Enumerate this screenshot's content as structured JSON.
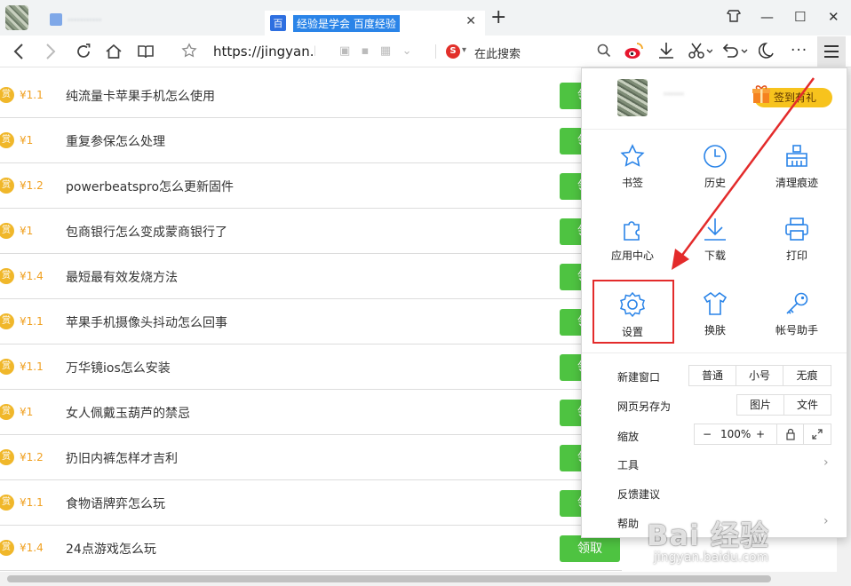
{
  "tabs": {
    "active_title": "经验是学会 百度经验",
    "inactive_title": "···········",
    "favicon_text": "百"
  },
  "window": {
    "minimize": "—",
    "maximize": "☐",
    "close": "✕",
    "wardrobe": "⌂"
  },
  "toolbar": {
    "url": "https://jingyan.b",
    "search_placeholder": "在此搜索",
    "sogou_glyph": "S"
  },
  "list": {
    "claim_label": "领取",
    "items": [
      {
        "reward": "¥1.1",
        "title": "纯流量卡苹果手机怎么使用"
      },
      {
        "reward": "¥1",
        "title": "重复参保怎么处理"
      },
      {
        "reward": "¥1.2",
        "title": "powerbeatspro怎么更新固件"
      },
      {
        "reward": "¥1",
        "title": "包商银行怎么变成蒙商银行了"
      },
      {
        "reward": "¥1.4",
        "title": "最短最有效发烧方法"
      },
      {
        "reward": "¥1.1",
        "title": "苹果手机摄像头抖动怎么回事"
      },
      {
        "reward": "¥1.1",
        "title": "万华镜ios怎么安装"
      },
      {
        "reward": "¥1",
        "title": "女人佩戴玉葫芦的禁忌"
      },
      {
        "reward": "¥1.2",
        "title": "扔旧内裤怎样才吉利"
      },
      {
        "reward": "¥1.1",
        "title": "食物语牌弈怎么玩"
      },
      {
        "reward": "¥1.4",
        "title": "24点游戏怎么玩"
      }
    ],
    "coin_glyph": "赏"
  },
  "menu": {
    "username": "······",
    "signin_label": "签到有礼",
    "grid": [
      {
        "label": "书签",
        "icon": "star-icon"
      },
      {
        "label": "历史",
        "icon": "clock-icon"
      },
      {
        "label": "清理痕迹",
        "icon": "broom-icon"
      },
      {
        "label": "应用中心",
        "icon": "puzzle-icon"
      },
      {
        "label": "下载",
        "icon": "download-icon"
      },
      {
        "label": "打印",
        "icon": "printer-icon"
      },
      {
        "label": "设置",
        "icon": "gear-icon"
      },
      {
        "label": "换肤",
        "icon": "shirt-icon"
      },
      {
        "label": "帐号助手",
        "icon": "key-icon"
      }
    ],
    "new_window": {
      "label": "新建窗口",
      "options": [
        "普通",
        "小号",
        "无痕"
      ]
    },
    "save_as": {
      "label": "网页另存为",
      "options": [
        "图片",
        "文件"
      ]
    },
    "zoom": {
      "label": "缩放",
      "minus": "−",
      "value": "100%",
      "plus": "+"
    },
    "tools_label": "工具",
    "feedback_label": "反馈建议",
    "help_label": "帮助"
  },
  "colors": {
    "accent_blue": "#2a84e8",
    "claim_green": "#4ec341",
    "highlight_red": "#e32b2b",
    "coin_gold": "#f0b72a"
  },
  "watermark": {
    "main": "Bai 经验",
    "sub": "jingyan.baidu.com"
  }
}
